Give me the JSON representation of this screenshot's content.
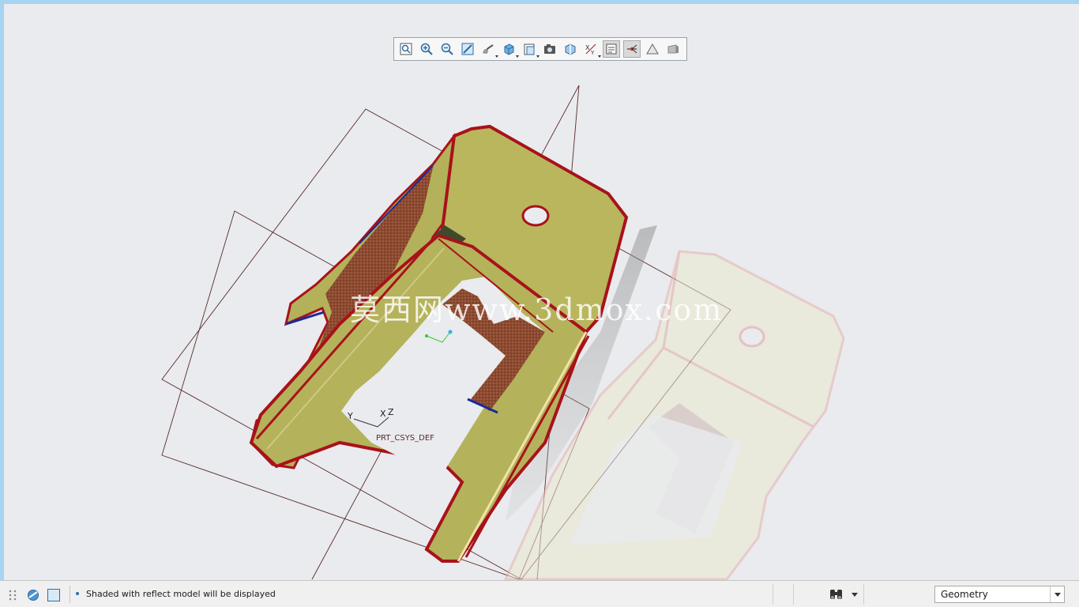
{
  "toolbar": {
    "buttons": [
      {
        "icon": "refit-icon",
        "active": false
      },
      {
        "icon": "zoom-in-icon",
        "active": false
      },
      {
        "icon": "zoom-out-icon",
        "active": false
      },
      {
        "icon": "repaint-icon",
        "active": false
      },
      {
        "icon": "display-style-icon",
        "active": false
      },
      {
        "icon": "saved-orientations-icon",
        "active": false
      },
      {
        "icon": "view-manager-icon",
        "active": false
      },
      {
        "icon": "perspective-icon",
        "active": false
      },
      {
        "icon": "section-icon",
        "active": false
      },
      {
        "icon": "datum-display-icon",
        "active": false
      },
      {
        "icon": "spin-center-icon",
        "active": true
      },
      {
        "icon": "annotation-display-icon",
        "active": true
      },
      {
        "icon": "appearance-icon",
        "active": false
      },
      {
        "icon": "animation-icon",
        "active": false
      }
    ]
  },
  "model": {
    "csys_label": "PRT_CSYS_DEF",
    "csys_x": "X",
    "csys_y": "Y",
    "csys_z": "Z",
    "watermark": "莫西网www.3dmox.com",
    "colors": {
      "body": "#b6b45a",
      "edge": "#a8121a",
      "cutout": "#8a4a2e",
      "datum": "#5a2a2a",
      "background": "#e9ebee"
    }
  },
  "status": {
    "message": "Shaded with reflect model will be displayed",
    "filter": {
      "selected": "Geometry"
    }
  }
}
